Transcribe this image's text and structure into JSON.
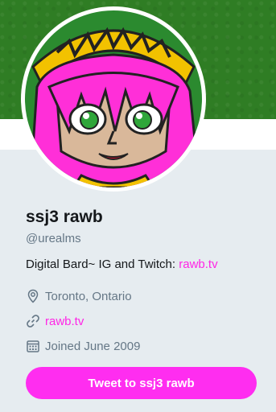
{
  "profile": {
    "display_name": "ssj3 rawb",
    "handle": "@urealms",
    "bio_prefix": "Digital Bard~ IG and Twitch: ",
    "bio_link": "rawb.tv",
    "location": "Toronto, Ontario",
    "website": "rawb.tv",
    "joined": "Joined June 2009",
    "tweet_button_label": "Tweet to ssj3 rawb"
  },
  "colors": {
    "banner": "#2f7d24",
    "accent": "#ff2df0",
    "link": "#ff26e6",
    "background": "#e6ecf0",
    "secondary_text": "#657786"
  },
  "icons": {
    "location": "map-pin-icon",
    "website": "link-icon",
    "joined": "calendar-icon"
  }
}
